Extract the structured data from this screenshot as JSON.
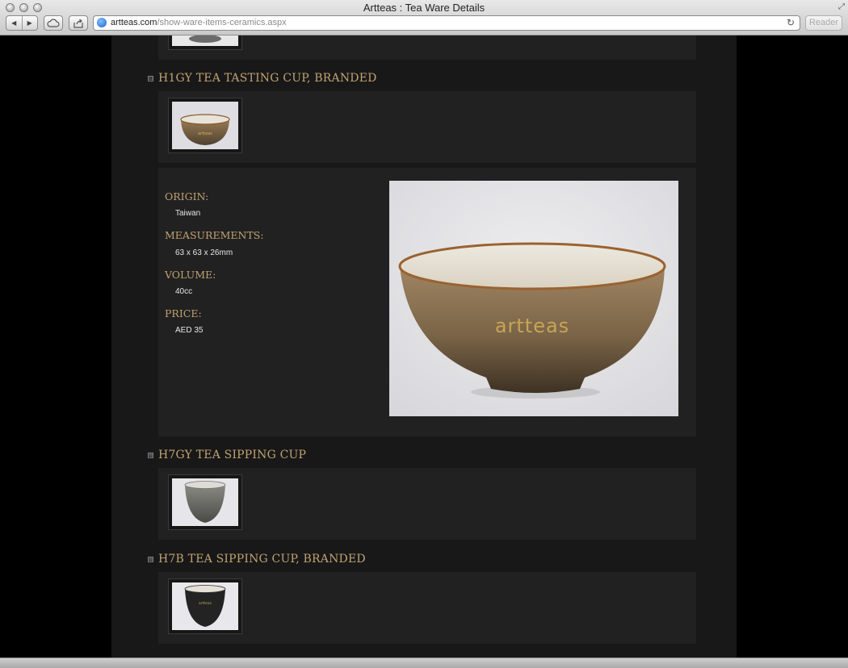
{
  "browser": {
    "title": "Artteas : Tea Ware Details",
    "url_domain": "artteas.com",
    "url_path": "/show-ware-items-ceramics.aspx",
    "reader_label": "Reader",
    "back_glyph": "◀",
    "forward_glyph": "▶",
    "reload_glyph": "↻",
    "resize_glyph": "⤢"
  },
  "items": [
    {
      "title": "H1GY TEA TASTING CUP, BRANDED",
      "toggle": "⊟",
      "thumb_icon": "brown-tasting-cup-photo"
    },
    {
      "title": "H7GY TEA SIPPING CUP",
      "toggle": "⊞",
      "thumb_icon": "grey-sipping-cup-photo"
    },
    {
      "title": "H7B TEA SIPPING CUP, BRANDED",
      "toggle": "⊞",
      "thumb_icon": "black-sipping-cup-photo"
    }
  ],
  "details": {
    "origin_label": "ORIGIN:",
    "origin_value": "Taiwan",
    "measurements_label": "MEASUREMENTS:",
    "measurements_value": "63 x 63 x 26mm",
    "volume_label": "VOLUME:",
    "volume_value": "40cc",
    "price_label": "PRICE:",
    "price_value": "AED 35"
  },
  "branding": {
    "logo_text": "artteas",
    "small_logo_text": "artteas"
  },
  "colors": {
    "accent": "#c1a272",
    "page_bg": "#181818",
    "panel_bg": "#212121"
  }
}
